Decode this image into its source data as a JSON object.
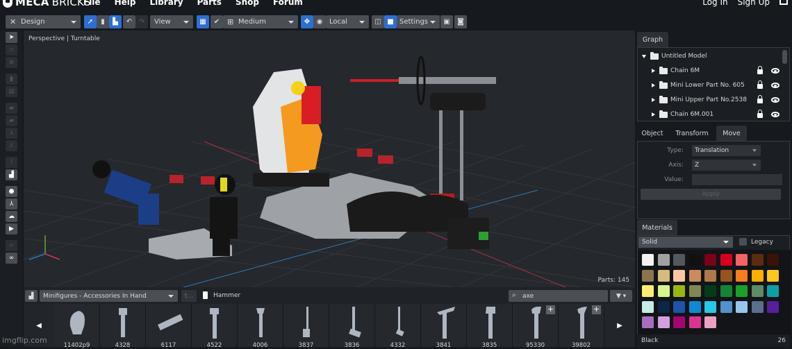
{
  "app": {
    "brand_bold": "MECA",
    "brand_light": "BRICKS",
    "nav": [
      "File",
      "Help",
      "Library",
      "Parts",
      "Shop",
      "Forum"
    ],
    "auth": {
      "login": "Log In",
      "signup": "Sign Up"
    }
  },
  "toolbar": {
    "mode_select": "Design",
    "view_select": "View",
    "quality_select": "Medium",
    "space_select": "Local",
    "settings_select": "Settings",
    "icons": [
      "add-brick-icon",
      "copy-bricks-icon",
      "paste-bricks-icon",
      "undo-icon",
      "redo-icon",
      "grid-icon",
      "check-icon",
      "table-icon",
      "pivot-icon",
      "center-icon",
      "box-outline-icon",
      "box-solid-icon",
      "save-icon",
      "camera-icon"
    ]
  },
  "leftbar": {
    "tools": [
      "select-arrow-icon",
      "magnet-icon",
      "target-icon",
      "clone-icon",
      "delete-icon",
      "folder-in-icon",
      "folder-out-icon",
      "axis-1-icon",
      "axis-2-icon",
      "graph-icon",
      "signal-bars-icon",
      "lightbulb-icon",
      "axes-icon",
      "landscape-icon",
      "video-camera-icon",
      "glasses-1-icon",
      "glasses-2-icon"
    ]
  },
  "viewport": {
    "label": "Perspective | Turntable",
    "parts_count": "Parts: 145"
  },
  "partsbar": {
    "category": "Minifigures - Accessories In Hand",
    "up_label": "t...",
    "current_part": "Hammer",
    "search_value": "axe",
    "parts": [
      {
        "id": "11402p9",
        "plus": false
      },
      {
        "id": "4328",
        "plus": false
      },
      {
        "id": "6117",
        "plus": false
      },
      {
        "id": "4522",
        "plus": false
      },
      {
        "id": "4006",
        "plus": false
      },
      {
        "id": "3837",
        "plus": false
      },
      {
        "id": "3836",
        "plus": false
      },
      {
        "id": "4332",
        "plus": false
      },
      {
        "id": "3841",
        "plus": false
      },
      {
        "id": "3835",
        "plus": false
      },
      {
        "id": "95330",
        "plus": true
      },
      {
        "id": "39802",
        "plus": true
      }
    ]
  },
  "graph": {
    "tab": "Graph",
    "root": "Untitled Model",
    "items": [
      "Chain 6M",
      "Mini Lower Part No. 605",
      "Mini Upper Part No.2538",
      "Chain 6M.001"
    ]
  },
  "props": {
    "tabs": [
      "Object",
      "Transform",
      "Move"
    ],
    "active_tab": "Move",
    "type_label": "Type:",
    "type_value": "Translation",
    "axis_label": "Axis:",
    "axis_value": "Z",
    "value_label": "Value:",
    "value_value": "",
    "apply": "Apply"
  },
  "materials": {
    "tab": "Materials",
    "finish": "Solid",
    "legacy": "Legacy",
    "selected_name": "Black",
    "selected_id": "26",
    "colors": [
      "#f2f3f2",
      "#a0a1a2",
      "#54585c",
      "#111111",
      "#7b0019",
      "#d6001c",
      "#f36265",
      "#5c2b10",
      "#3a120a",
      "#8b7551",
      "#d6bb7d",
      "#fbc7a3",
      "#cd8a5e",
      "#b07848",
      "#98541f",
      "#f47d20",
      "#fbae00",
      "#fdc71e",
      "#fdee73",
      "#d7f58f",
      "#98b811",
      "#7f8753",
      "#053b1a",
      "#138534",
      "#19a028",
      "#5e8a66",
      "#0ba1a4",
      "#c6ebe4",
      "#0b2647",
      "#1f52ab",
      "#0c8ad4",
      "#28c9e6",
      "#5391cf",
      "#96c6ed",
      "#5a6e8f",
      "#571f9b",
      "#a66ebd",
      "#d39fe0",
      "#a4066f",
      "#dc3492",
      "#eca0c8"
    ]
  },
  "watermark": "imgflip.com"
}
